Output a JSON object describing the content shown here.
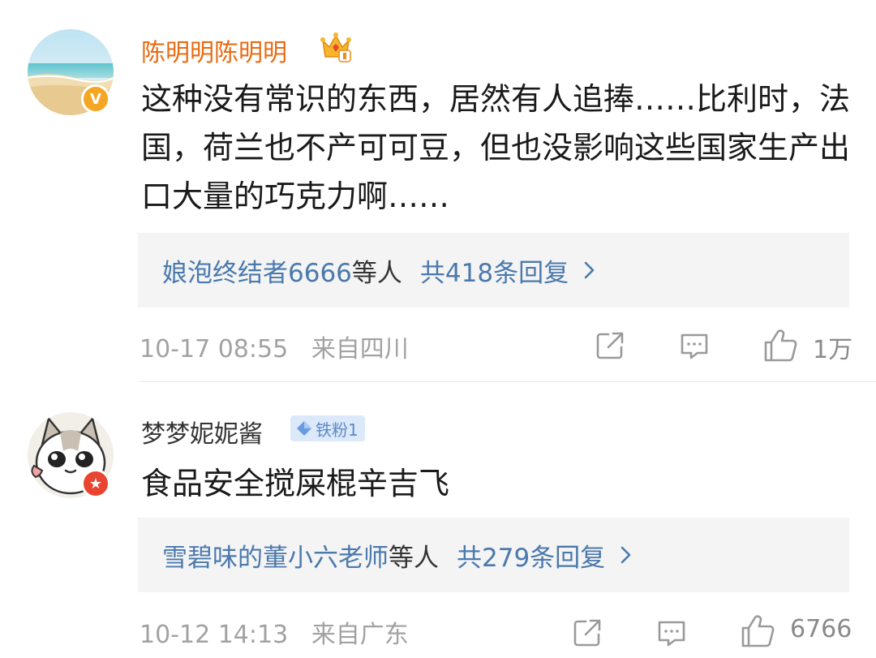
{
  "comments": [
    {
      "username": "陈明明陈明明",
      "avatar": "beach-avatar",
      "badge": "verified-v-icon",
      "badge_text": "V",
      "member_icon": "crown-vip-icon",
      "content": "这种没有常识的东西，居然有人追捧……比利时，法国，荷兰也不产可可豆，但也没影响这些国家生产出口大量的巧克力啊……",
      "replies": {
        "names": "娘泡终结者6666",
        "suffix": "等人",
        "total": "共418条回复"
      },
      "time": "10-17 08:55",
      "location": "来自四川",
      "likes": "1万"
    },
    {
      "username": "梦梦妮妮酱",
      "avatar": "cartoon-cat-avatar",
      "badge": "red-star-icon",
      "badge_text": "★",
      "fan_badge": "铁粉1",
      "content": "食品安全搅屎棍辛吉飞",
      "replies": {
        "names": "雪碧味的董小六老师",
        "suffix": "等人",
        "total": "共279条回复"
      },
      "time": "10-12 14:13",
      "location": "来自广东",
      "likes": "6766"
    }
  ],
  "colors": {
    "vip_name": "#e86b12",
    "link": "#4a79ad",
    "meta": "#a2a2a2",
    "reply_bg": "#f4f4f4",
    "fan_tag_bg": "#dbe9fa",
    "fan_tag_text": "#5c89c4"
  }
}
